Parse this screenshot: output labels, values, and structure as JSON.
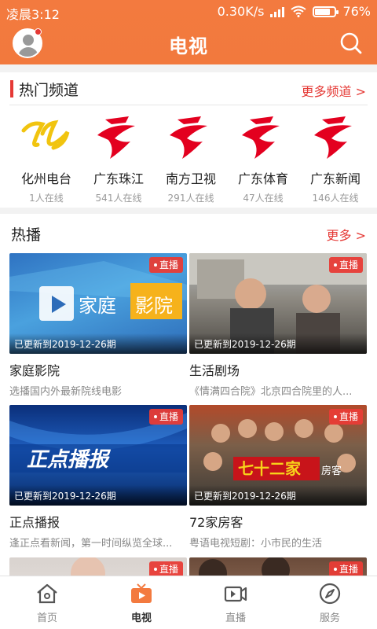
{
  "status_bar": {
    "time": "凌晨3:12",
    "network_speed": "0.30K/s",
    "battery": "76%",
    "battery_level": 0.76
  },
  "header": {
    "title": "电视",
    "avatar_icon": "user-avatar-icon",
    "search_icon": "search-icon"
  },
  "hot_channels": {
    "title": "热门频道",
    "more_label": "更多频道 >",
    "items": [
      {
        "name": "化州电台",
        "online": "1人在线"
      },
      {
        "name": "广东珠江",
        "online": "541人在线"
      },
      {
        "name": "南方卫视",
        "online": "291人在线"
      },
      {
        "name": "广东体育",
        "online": "47人在线"
      },
      {
        "name": "广东新闻",
        "online": "146人在线"
      }
    ]
  },
  "hot_shows": {
    "title": "热播",
    "more_label": "更多 >",
    "items": [
      {
        "title": "家庭影院",
        "desc": "选播国内外最新院线电影",
        "badge": "直播",
        "updated": "已更新到2019-12-26期",
        "art_text_1": "家庭",
        "art_text_2": "影院"
      },
      {
        "title": "生活剧场",
        "desc": "《情满四合院》北京四合院里的人...",
        "badge": "直播",
        "updated": "已更新到2019-12-26期"
      },
      {
        "title": "正点播报",
        "desc": "逢正点看新闻，第一时间纵览全球...",
        "badge": "直播",
        "updated": "已更新到2019-12-26期",
        "art_text_1": "正点播报"
      },
      {
        "title": "72家房客",
        "desc": "粤语电视短剧：小市民的生活",
        "badge": "直播",
        "updated": "已更新到2019-12-26期",
        "art_text_1": "七十二家",
        "art_text_2": "房客"
      },
      {
        "badge": "直播"
      },
      {
        "badge": "直播"
      }
    ]
  },
  "bottom_nav": {
    "items": [
      {
        "label": "首页",
        "icon": "home-icon"
      },
      {
        "label": "电视",
        "icon": "tv-icon"
      },
      {
        "label": "直播",
        "icon": "live-video-icon"
      },
      {
        "label": "服务",
        "icon": "compass-icon"
      }
    ],
    "active": "电视"
  },
  "colors": {
    "brand_orange": "#f37a3f",
    "accent_red": "#e53935"
  }
}
